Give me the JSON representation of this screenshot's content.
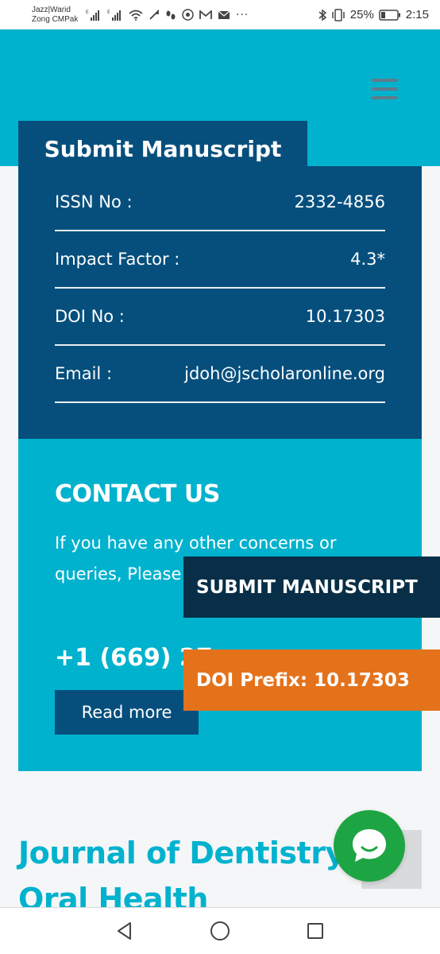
{
  "status_bar": {
    "carrier_line1": "Jazz|Warid",
    "carrier_line2": "Zong CMPak",
    "more_dots": "···",
    "battery_percent": "25%",
    "time": "2:15"
  },
  "header": {
    "submit_label": "Submit Manuscript"
  },
  "info": {
    "rows": [
      {
        "label": "ISSN No :",
        "value": "2332-4856"
      },
      {
        "label": "Impact Factor :",
        "value": "4.3*"
      },
      {
        "label": "DOI No :",
        "value": "10.17303"
      },
      {
        "label": "Email :",
        "value": "jdoh@jscholaronline.org"
      }
    ]
  },
  "contact": {
    "title": "CONTACT US",
    "text": "If you have any other concerns or queries, Please",
    "phone": "+1 (669) 27",
    "read_more": "Read more"
  },
  "floating": {
    "submit_label": "SUBMIT MANUSCRIPT",
    "doi_label": "DOI Prefix: 10.17303"
  },
  "journal": {
    "title": "Journal of Dentistry and Oral Health"
  },
  "colors": {
    "accent": "#00b2cd",
    "navy": "#064f7d",
    "orange": "#e4721b",
    "chat_green": "#1ea543"
  },
  "icons": {
    "menu": "hamburger-icon",
    "chat": "chat-icon",
    "back": "back-triangle-icon",
    "home": "home-circle-icon",
    "recents": "recents-square-icon"
  }
}
